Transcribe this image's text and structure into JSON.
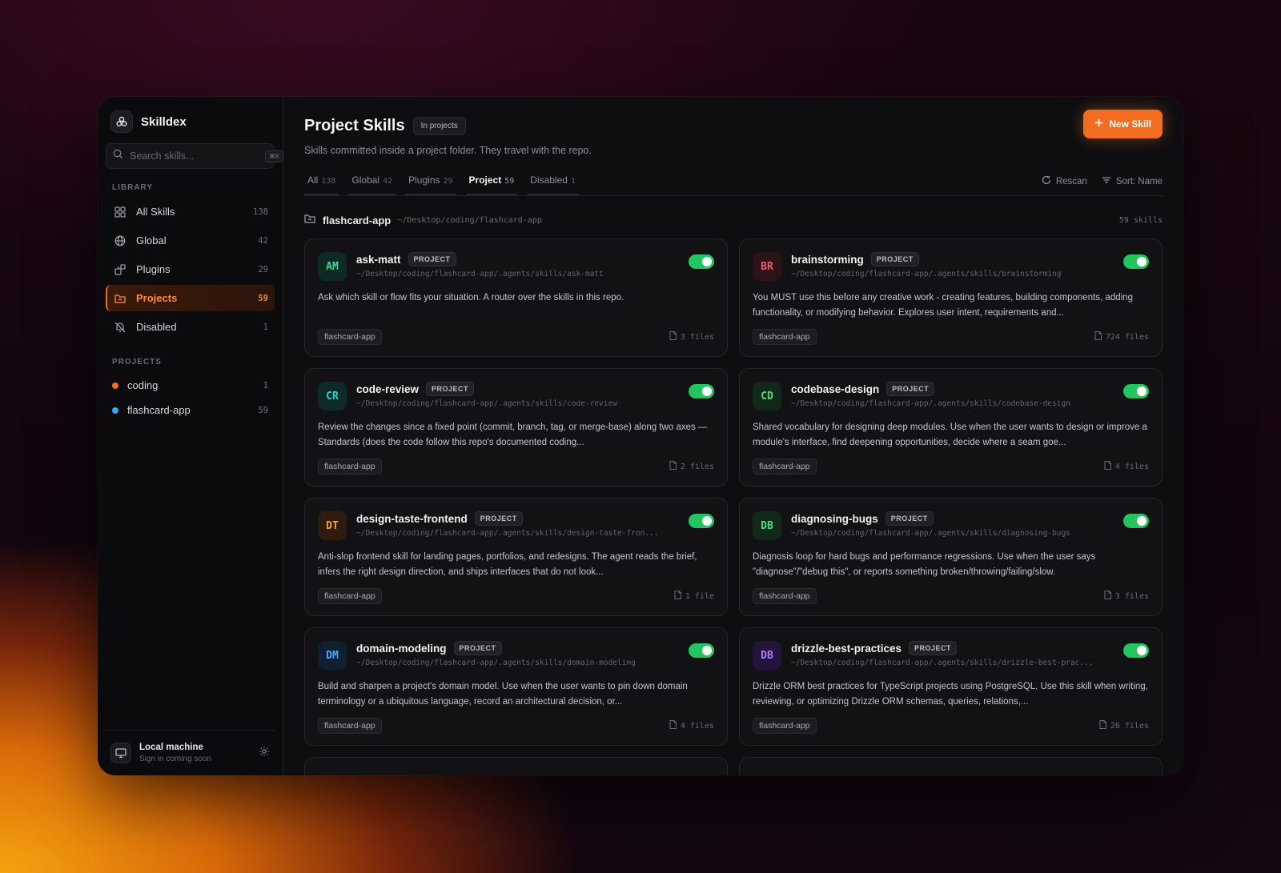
{
  "app": {
    "name": "Skilldex",
    "search_placeholder": "Search skills...",
    "search_shortcut": "⌘K"
  },
  "sidebar": {
    "library_label": "LIBRARY",
    "library_items": [
      {
        "label": "All Skills",
        "count": "138",
        "icon": "grid-icon"
      },
      {
        "label": "Global",
        "count": "42",
        "icon": "globe-icon"
      },
      {
        "label": "Plugins",
        "count": "29",
        "icon": "plugin-icon"
      },
      {
        "label": "Projects",
        "count": "59",
        "icon": "project-folder-icon",
        "active": true
      },
      {
        "label": "Disabled",
        "count": "1",
        "icon": "disabled-icon"
      }
    ],
    "projects_label": "PROJECTS",
    "projects": [
      {
        "label": "coding",
        "count": "1",
        "color": "#f26d1f"
      },
      {
        "label": "flashcard-app",
        "count": "59",
        "color": "#3aa7f0"
      }
    ],
    "footer": {
      "title": "Local machine",
      "subtitle": "Sign in coming soon"
    }
  },
  "header": {
    "title": "Project Skills",
    "badge": "In projects",
    "subtitle": "Skills committed inside a project folder. They travel with the repo.",
    "new_button": "New Skill"
  },
  "tabs": [
    {
      "label": "All",
      "count": "138"
    },
    {
      "label": "Global",
      "count": "42"
    },
    {
      "label": "Plugins",
      "count": "29"
    },
    {
      "label": "Project",
      "count": "59",
      "active": true
    },
    {
      "label": "Disabled",
      "count": "1"
    }
  ],
  "actions": {
    "rescan": "Rescan",
    "sort": "Sort: Name"
  },
  "folder": {
    "name": "flashcard-app",
    "path": "~/Desktop/coding/flashcard-app",
    "count": "59 skills"
  },
  "badge_label": "PROJECT",
  "colors": {
    "accent": "#f26d1f",
    "toggle_on": "#22c55e"
  },
  "cards": [
    {
      "initials": "AM",
      "name": "ask-matt",
      "path": "~/Desktop/coding/flashcard-app/.agents/skills/ask-matt",
      "desc": "Ask which skill or flow fits your situation. A router over the skills in this repo.",
      "tag": "flashcard-app",
      "files": "3 files",
      "bg": "#0f2a24",
      "fg": "#3ddc97"
    },
    {
      "initials": "BR",
      "name": "brainstorming",
      "path": "~/Desktop/coding/flashcard-app/.agents/skills/brainstorming",
      "desc": "You MUST use this before any creative work - creating features, building components, adding functionality, or modifying behavior. Explores user intent, requirements and...",
      "tag": "flashcard-app",
      "files": "724 files",
      "bg": "#2d1218",
      "fg": "#f05a6e"
    },
    {
      "initials": "CR",
      "name": "code-review",
      "path": "~/Desktop/coding/flashcard-app/.agents/skills/code-review",
      "desc": "Review the changes since a fixed point (commit, branch, tag, or merge-base) along two axes — Standards (does the code follow this repo's documented coding...",
      "tag": "flashcard-app",
      "files": "2 files",
      "bg": "#0e2a2a",
      "fg": "#2fd3c6"
    },
    {
      "initials": "CD",
      "name": "codebase-design",
      "path": "~/Desktop/coding/flashcard-app/.agents/skills/codebase-design",
      "desc": "Shared vocabulary for designing deep modules. Use when the user wants to design or improve a module's interface, find deepening opportunities, decide where a seam goe...",
      "tag": "flashcard-app",
      "files": "4 files",
      "bg": "#12281a",
      "fg": "#4ade80"
    },
    {
      "initials": "DT",
      "name": "design-taste-frontend",
      "path": "~/Desktop/coding/flashcard-app/.agents/skills/design-taste-fron...",
      "desc": "Anti-slop frontend skill for landing pages, portfolios, and redesigns. The agent reads the brief, infers the right design direction, and ships interfaces that do not look...",
      "tag": "flashcard-app",
      "files": "1 file",
      "bg": "#2e1c0e",
      "fg": "#f59e42"
    },
    {
      "initials": "DB",
      "name": "diagnosing-bugs",
      "path": "~/Desktop/coding/flashcard-app/.agents/skills/diagnosing-bugs",
      "desc": "Diagnosis loop for hard bugs and performance regressions. Use when the user says \"diagnose\"/\"debug this\", or reports something broken/throwing/failing/slow.",
      "tag": "flashcard-app",
      "files": "3 files",
      "bg": "#12281a",
      "fg": "#4ade80"
    },
    {
      "initials": "DM",
      "name": "domain-modeling",
      "path": "~/Desktop/coding/flashcard-app/.agents/skills/domain-modeling",
      "desc": "Build and sharpen a project's domain model. Use when the user wants to pin down domain terminology or a ubiquitous language, record an architectural decision, or...",
      "tag": "flashcard-app",
      "files": "4 files",
      "bg": "#0f2033",
      "fg": "#4aa8ff"
    },
    {
      "initials": "DB",
      "name": "drizzle-best-practices",
      "path": "~/Desktop/coding/flashcard-app/.agents/skills/drizzle-best-prac...",
      "desc": "Drizzle ORM best practices for TypeScript projects using PostgreSQL. Use this skill when writing, reviewing, or optimizing Drizzle ORM schemas, queries, relations,...",
      "tag": "flashcard-app",
      "files": "26 files",
      "bg": "#22143a",
      "fg": "#b07cff"
    }
  ]
}
